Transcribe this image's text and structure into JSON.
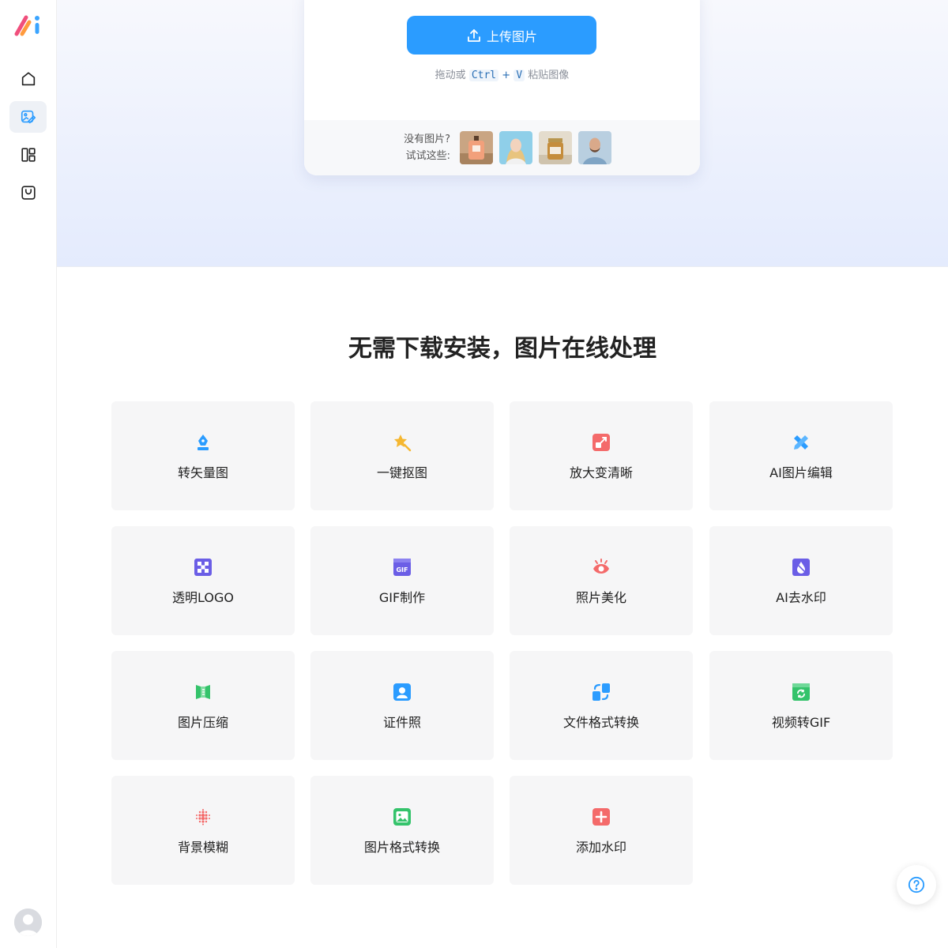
{
  "app": {
    "logo_icon": "brand-logo",
    "accent_color": "#2b9cff"
  },
  "sidebar": {
    "items": [
      {
        "icon": "home-icon"
      },
      {
        "icon": "image-edit-icon",
        "active": true
      },
      {
        "icon": "layout-icon"
      },
      {
        "icon": "bag-icon"
      }
    ],
    "avatar_icon": "avatar-placeholder"
  },
  "upload": {
    "button_label": "上传图片",
    "hint_prefix": "拖动或",
    "hint_key_ctrl": "Ctrl",
    "hint_plus": "+",
    "hint_key_v": "V",
    "hint_suffix": "粘贴图像",
    "samples_label_line1": "没有图片?",
    "samples_label_line2": "试试这些:",
    "samples": [
      "perfume-bottle-photo",
      "woman-portrait-photo",
      "jar-product-photo",
      "man-portrait-photo"
    ]
  },
  "section": {
    "title": "无需下载安装，图片在线处理"
  },
  "tools": [
    {
      "label": "转矢量图",
      "icon": "pen-nib-icon",
      "color": "#2b9cff"
    },
    {
      "label": "一键抠图",
      "icon": "magic-star-icon",
      "color": "#f5b731"
    },
    {
      "label": "放大变清晰",
      "icon": "expand-icon",
      "color": "#f46a6a"
    },
    {
      "label": "AI图片编辑",
      "icon": "pencil-ruler-icon",
      "color": "#2b9cff"
    },
    {
      "label": "透明LOGO",
      "icon": "checker-icon",
      "color": "#6b5ee6"
    },
    {
      "label": "GIF制作",
      "icon": "gif-icon",
      "color": "#6b5ee6"
    },
    {
      "label": "照片美化",
      "icon": "eye-icon",
      "color": "#f46a6a"
    },
    {
      "label": "AI去水印",
      "icon": "watermark-drop-icon",
      "color": "#6b5ee6"
    },
    {
      "label": "图片压缩",
      "icon": "compress-icon",
      "color": "#34c36b"
    },
    {
      "label": "证件照",
      "icon": "id-photo-icon",
      "color": "#2b9cff"
    },
    {
      "label": "文件格式转换",
      "icon": "file-convert-icon",
      "color": "#2b9cff"
    },
    {
      "label": "视频转GIF",
      "icon": "video-convert-icon",
      "color": "#34c36b"
    },
    {
      "label": "背景模糊",
      "icon": "blur-dots-icon",
      "color": "#f46a6a"
    },
    {
      "label": "图片格式转换",
      "icon": "image-icon",
      "color": "#34c36b"
    },
    {
      "label": "添加水印",
      "icon": "plus-square-icon",
      "color": "#f46a6a"
    }
  ],
  "help": {
    "icon": "help-icon"
  }
}
